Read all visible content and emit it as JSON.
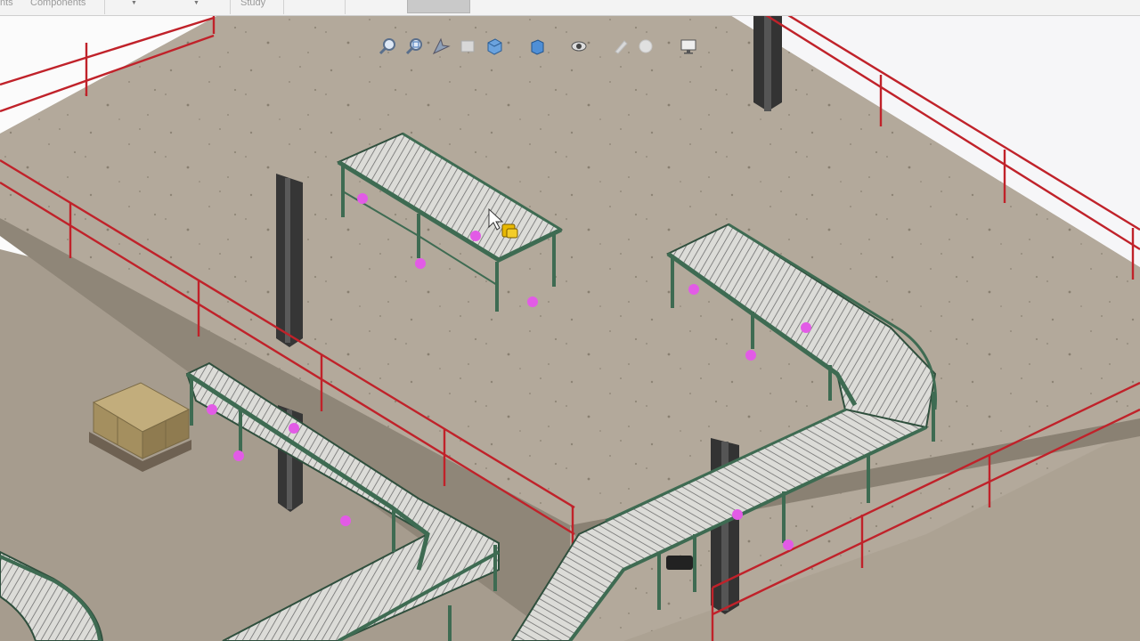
{
  "command_manager": {
    "tabs": [
      {
        "label": "nts",
        "active": false
      },
      {
        "label": "Components",
        "active": false
      },
      {
        "label": "Study",
        "active": false
      },
      {
        "label": "",
        "active": true
      }
    ]
  },
  "heads_up_toolbar": [
    {
      "name": "zoom-to-fit-icon",
      "enabled": true
    },
    {
      "name": "zoom-to-area-icon",
      "enabled": true
    },
    {
      "name": "previous-view-icon",
      "enabled": true
    },
    {
      "name": "section-view-icon",
      "enabled": false
    },
    {
      "name": "view-orientation-icon",
      "enabled": true
    },
    {
      "name": "display-style-icon",
      "enabled": true
    },
    {
      "name": "hide-show-items-icon",
      "enabled": true
    },
    {
      "name": "edit-appearance-icon",
      "enabled": false
    },
    {
      "name": "apply-scene-icon",
      "enabled": false
    },
    {
      "name": "view-settings-icon",
      "enabled": true
    }
  ],
  "scene": {
    "floor_color": "#b4aa9c",
    "railing_color": "#c0222a",
    "frame_color": "#3e6b52",
    "roller_color": "#d6d6d2",
    "connection_point_color": "#e25be6",
    "column_color": "#3c3c3c",
    "pallet_color": "#a08b5e",
    "mate_indicator_color": "#e8b800"
  }
}
